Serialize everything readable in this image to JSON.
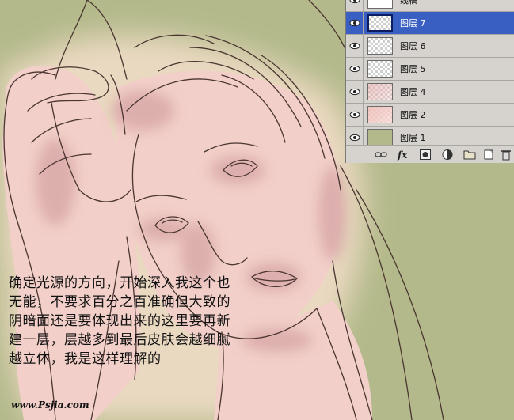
{
  "tutorial": {
    "text": "确定光源的方向，开始深入我这个也无能，不要求百分之百准确但大致的阴暗面还是要体现出来的这里要再新建一层，层越多到最后皮肤会越细腻越立体，我是这样理解的"
  },
  "watermark": "www.Psjia.com",
  "layers_panel": {
    "layers": [
      {
        "name": "线稿",
        "visible": true,
        "selected": false,
        "thumb": "lineart"
      },
      {
        "name": "图层 7",
        "visible": true,
        "selected": true,
        "thumb": "transparent"
      },
      {
        "name": "图层 6",
        "visible": true,
        "selected": false,
        "thumb": "transparent"
      },
      {
        "name": "图层 5",
        "visible": true,
        "selected": false,
        "thumb": "transparent"
      },
      {
        "name": "图层 4",
        "visible": true,
        "selected": false,
        "thumb": "pink-light"
      },
      {
        "name": "图层 2",
        "visible": true,
        "selected": false,
        "thumb": "pink"
      },
      {
        "name": "图层 1",
        "visible": true,
        "selected": false,
        "thumb": "green"
      }
    ],
    "toolbar": [
      "link-icon",
      "fx-icon",
      "mask-icon",
      "adjustment-icon",
      "folder-icon",
      "new-layer-icon",
      "trash-icon"
    ]
  },
  "colors": {
    "background_green": "#b3b98a",
    "skin": "#f3d2cb",
    "skin_shadow": "#d9a9a8",
    "line": "#4a3530",
    "panel_bg": "#d6d3ce",
    "selected": "#3a5fc2"
  }
}
